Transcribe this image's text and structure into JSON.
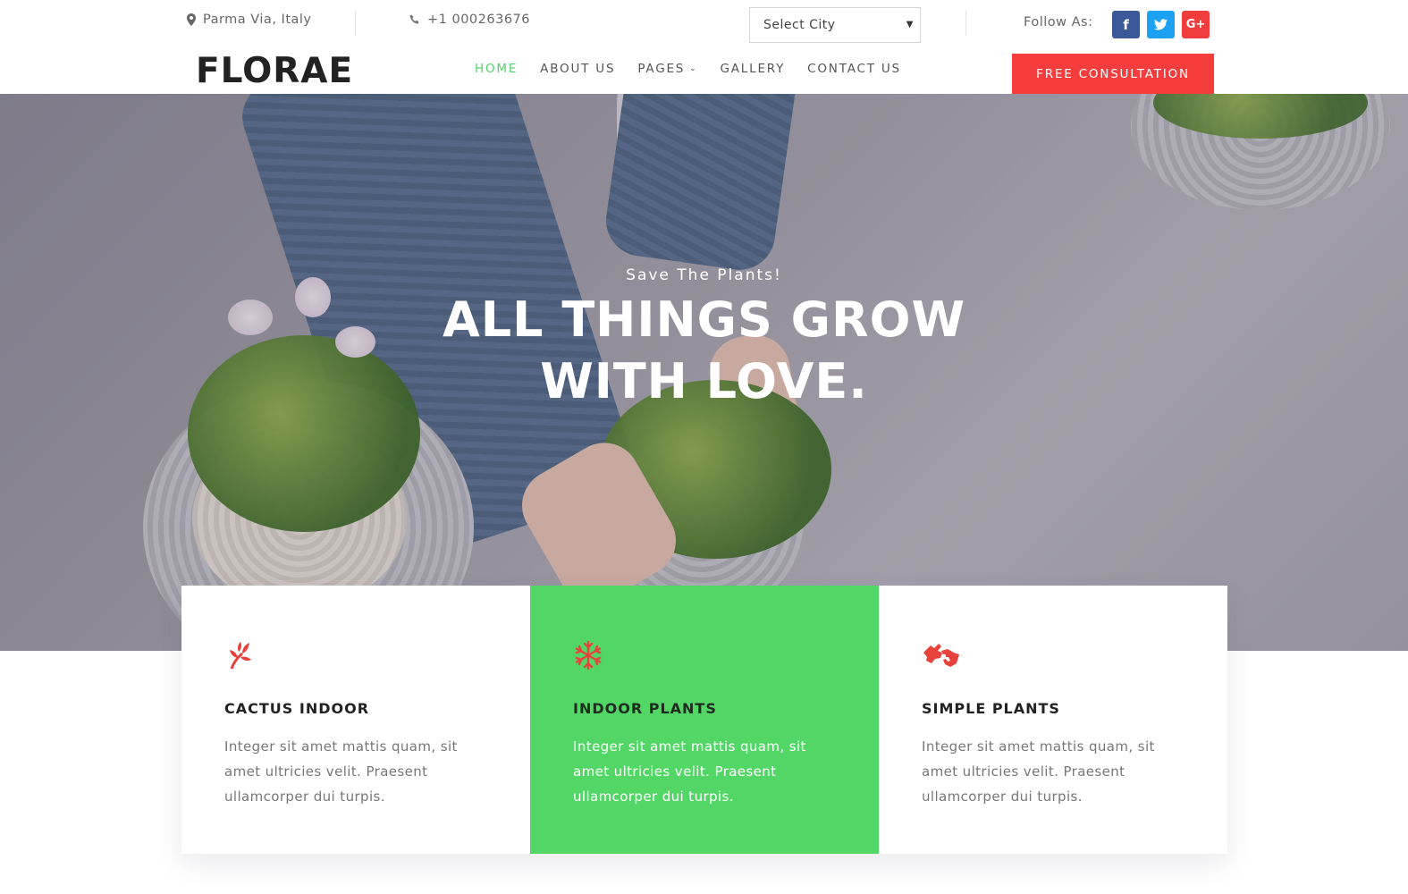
{
  "topbar": {
    "location": "Parma Via, Italy",
    "phone": "+1 000263676",
    "city_select": "Select City",
    "follow_label": "Follow As:",
    "social": [
      {
        "name": "facebook",
        "glyph": "f",
        "color": "#3b5998"
      },
      {
        "name": "twitter",
        "glyph": "t",
        "color": "#1da1f2"
      },
      {
        "name": "google-plus",
        "glyph": "G+",
        "color": "#f03c3c"
      }
    ]
  },
  "header": {
    "logo": "FLORAE",
    "nav": [
      "HOME",
      "ABOUT US",
      "PAGES",
      "GALLERY",
      "CONTACT US"
    ],
    "cta": "FREE CONSULTATION"
  },
  "hero": {
    "subtitle": "Save The Plants!",
    "title_line1": "ALL THINGS GROW",
    "title_line2": "WITH LOVE."
  },
  "features": [
    {
      "icon": "leaf-icon",
      "title": "CACTUS INDOOR",
      "text": "Integer sit amet mattis quam, sit amet ultricies velit. Praesent ullamcorper dui turpis."
    },
    {
      "icon": "snowflake-icon",
      "title": "INDOOR PLANTS",
      "text": "Integer sit amet mattis quam, sit amet ultricies velit. Praesent ullamcorper dui turpis."
    },
    {
      "icon": "hands-icon",
      "title": "SIMPLE PLANTS",
      "text": "Integer sit amet mattis quam, sit amet ultricies velit. Praesent ullamcorper dui turpis."
    }
  ],
  "colors": {
    "accent_green": "#52d666",
    "cta_red": "#f53d3d",
    "icon_red": "#e8423d"
  }
}
